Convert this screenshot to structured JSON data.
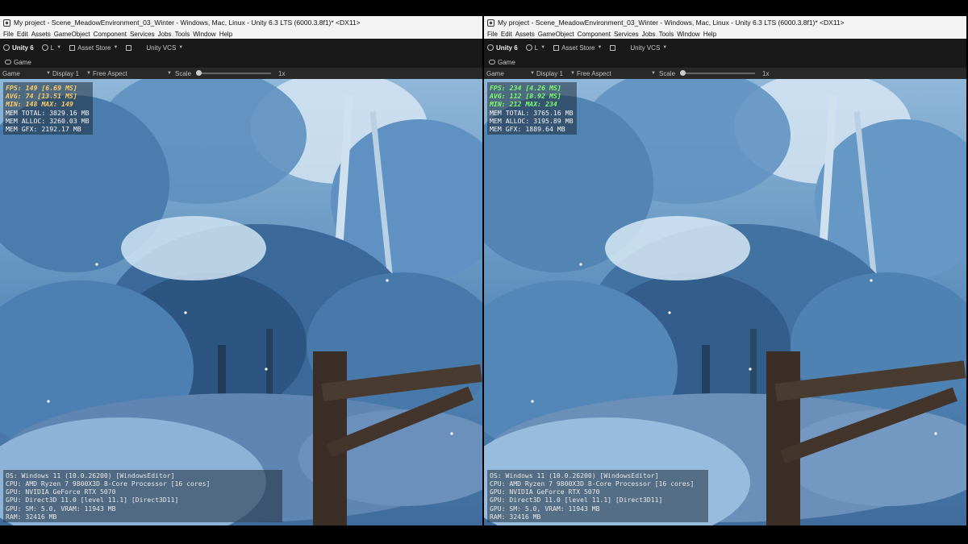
{
  "window": {
    "title": "My project - Scene_MeadowEnvironment_03_Winter - Windows, Mac, Linux - Unity 6.3 LTS (6000.3.8f1)* <DX11>"
  },
  "menu": [
    "File",
    "Edit",
    "Assets",
    "GameObject",
    "Component",
    "Services",
    "Jobs",
    "Tools",
    "Window",
    "Help"
  ],
  "toolbar": {
    "unity_label": "Unity 6",
    "account_label": "L",
    "asset_store_label": "Asset Store",
    "vcs_label": "Unity VCS"
  },
  "tab": {
    "game_label": "Game"
  },
  "gamebar": {
    "view_label": "Game",
    "display_label": "Display 1",
    "aspect_label": "Free Aspect",
    "scale_label": "Scale",
    "scale_value": "1x"
  },
  "panels": {
    "left": {
      "stats": {
        "fps": "FPS: 149 [6.69 MS]",
        "avg": "AVG: 74 [13.51 MS]",
        "minmax": "MIN: 148 MAX: 149",
        "mem_total": "MEM TOTAL: 3829.16 MB",
        "mem_alloc": "MEM ALLOC: 3260.03 MB",
        "mem_gfx": "MEM GFX: 2192.17 MB"
      },
      "sysinfo": {
        "os": "OS: Windows 11  (10.0.26200) [WindowsEditor]",
        "cpu": "CPU: AMD Ryzen 7 9800X3D 8-Core Processor  [16 cores]",
        "gpu_name": "GPU: NVIDIA GeForce RTX 5070",
        "gpu_api": "GPU: Direct3D 11.0 [level 11.1] [Direct3D11]",
        "gpu_sm": "GPU: SM: 5.0, VRAM: 11943 MB",
        "ram": "RAM: 32416 MB"
      }
    },
    "right": {
      "stats": {
        "fps": "FPS: 234 [4.26 MS]",
        "avg": "AVG: 112 [8.92 MS]",
        "minmax": "MIN: 212 MAX: 234",
        "mem_total": "MEM TOTAL: 3765.16 MB",
        "mem_alloc": "MEM ALLOC: 3195.89 MB",
        "mem_gfx": "MEM GFX: 1889.64 MB"
      },
      "sysinfo": {
        "os": "OS: Windows 11  (10.0.26200) [WindowsEditor]",
        "cpu": "CPU: AMD Ryzen 7 9800X3D 8-Core Processor  [16 cores]",
        "gpu_name": "GPU: NVIDIA GeForce RTX 5070",
        "gpu_api": "GPU: Direct3D 11.0 [level 11.1] [Direct3D11]",
        "gpu_sm": "GPU: SM: 5.0, VRAM: 11943 MB",
        "ram": "RAM: 32416 MB"
      }
    }
  },
  "colors": {
    "fps_left": "#ffcc66",
    "fps_right": "#7dff6a",
    "scene_sky": "#8fb7d8",
    "scene_foliage": "#4f82b3",
    "fence": "#3a2e26"
  }
}
